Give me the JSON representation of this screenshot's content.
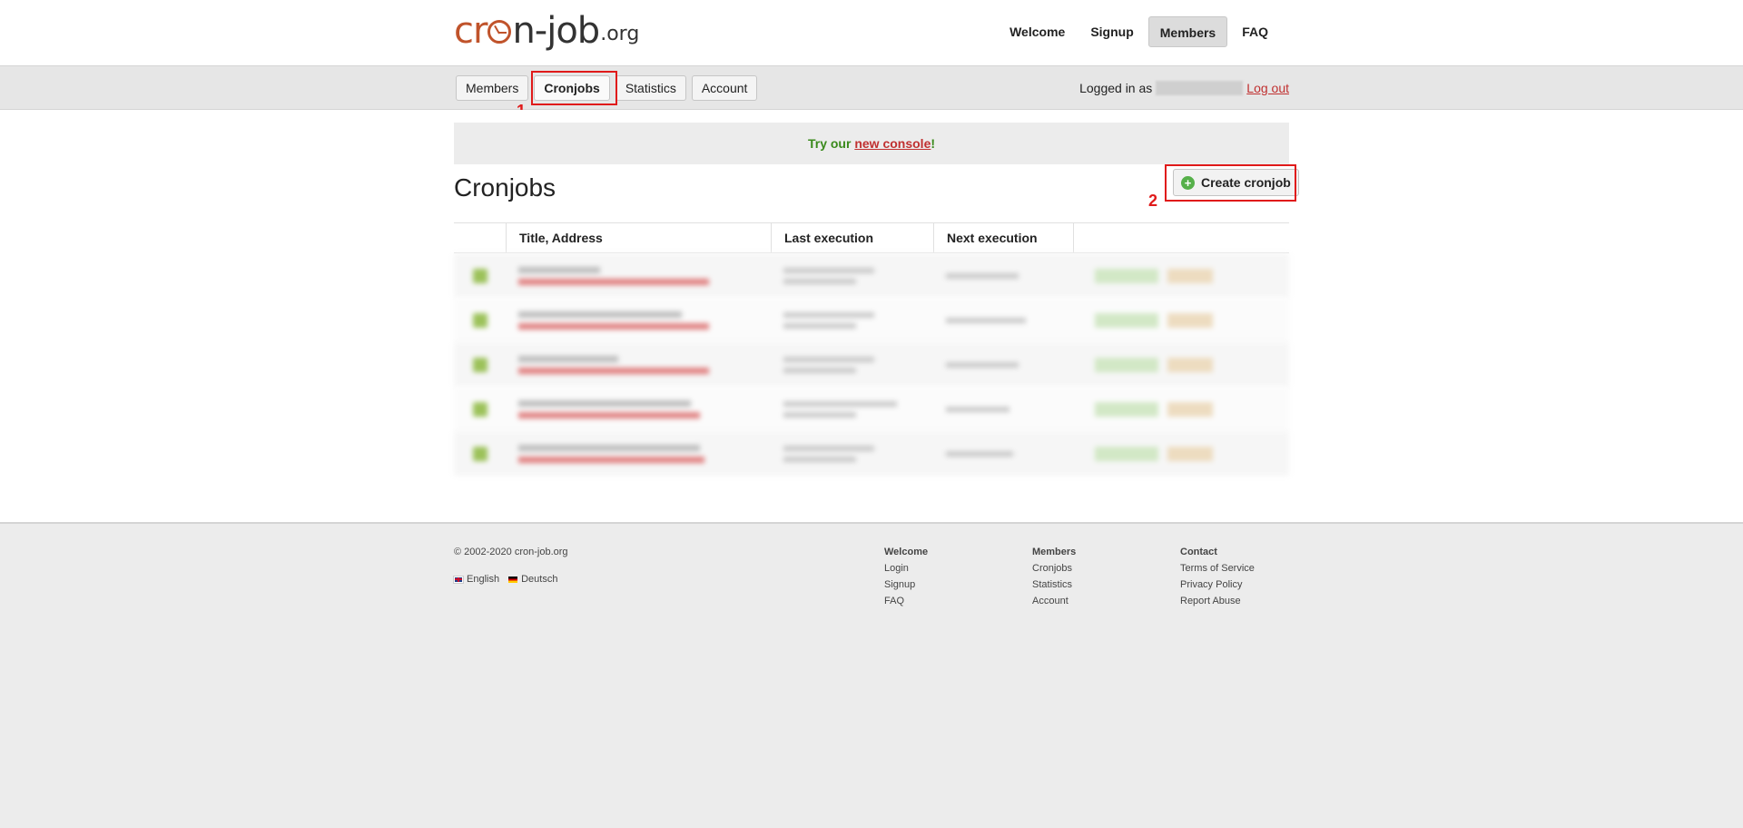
{
  "header": {
    "logo": {
      "part1": "cr",
      "part2": "n-job",
      "tld": ".org"
    },
    "nav": [
      "Welcome",
      "Signup",
      "Members",
      "FAQ"
    ],
    "active_nav": "Members"
  },
  "subnav": {
    "items": [
      "Members",
      "Cronjobs",
      "Statistics",
      "Account"
    ],
    "active": "Cronjobs",
    "logged_in_label": "Logged in as",
    "logout_label": "Log out"
  },
  "annotations": {
    "marker1": "1",
    "marker2": "2"
  },
  "notice": {
    "prefix": "Try our ",
    "link": "new console",
    "suffix": "!"
  },
  "main": {
    "title": "Cronjobs",
    "create_button": "Create cronjob",
    "columns": [
      "",
      "Title, Address",
      "Last execution",
      "Next execution",
      ""
    ]
  },
  "footer": {
    "copyright": "© 2002-2020 cron-job.org",
    "languages": [
      "English",
      "Deutsch"
    ],
    "columns": [
      {
        "heading": "Welcome",
        "links": [
          "Login",
          "Signup",
          "FAQ"
        ]
      },
      {
        "heading": "Members",
        "links": [
          "Cronjobs",
          "Statistics",
          "Account"
        ]
      },
      {
        "heading": "Contact",
        "links": [
          "Terms of Service",
          "Privacy Policy",
          "Report Abuse"
        ]
      }
    ]
  },
  "colors": {
    "accent": "#c0532b",
    "annotation": "#e01a1a",
    "notice_text": "#3a8a1c",
    "link": "#c03030"
  }
}
